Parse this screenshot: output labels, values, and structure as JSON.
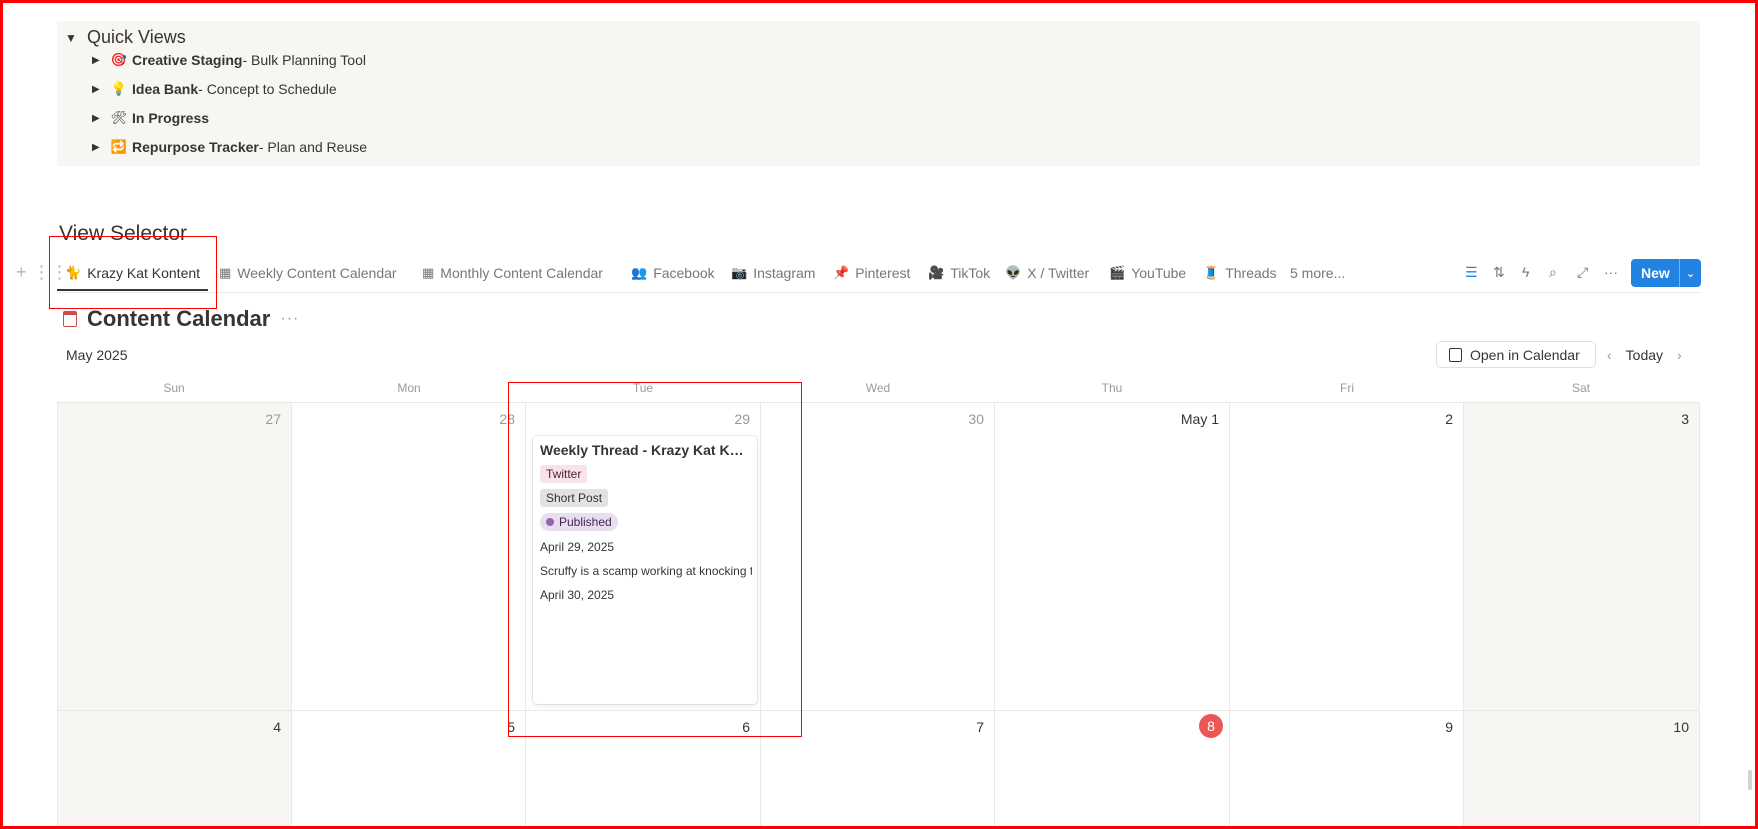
{
  "quick_views": {
    "title": "Quick Views",
    "items": [
      {
        "icon": "🎯",
        "name": "Creative Staging",
        "sub": " - Bulk Planning Tool"
      },
      {
        "icon": "💡",
        "name": "Idea Bank",
        "sub": " - Concept to Schedule"
      },
      {
        "icon": "🛠",
        "name": "In Progress",
        "sub": ""
      },
      {
        "icon": "🔁",
        "name": "Repurpose Tracker",
        "sub": " - Plan and Reuse"
      }
    ]
  },
  "view_selector": {
    "title": "View Selector",
    "tabs": [
      {
        "icon": "🐈",
        "label": "Krazy Kat Kontent"
      },
      {
        "icon": "▦",
        "label": "Weekly Content Calendar"
      },
      {
        "icon": "▦",
        "label": "Monthly Content Calendar"
      },
      {
        "icon": "👥",
        "label": "Facebook"
      },
      {
        "icon": "📷",
        "label": "Instagram"
      },
      {
        "icon": "📌",
        "label": "Pinterest"
      },
      {
        "icon": "🎥",
        "label": "TikTok"
      },
      {
        "icon": "👽",
        "label": "X / Twitter"
      },
      {
        "icon": "🎬",
        "label": "YouTube"
      },
      {
        "icon": "🧵",
        "label": "Threads"
      }
    ],
    "more_label": "5 more...",
    "new_label": "New"
  },
  "calendar": {
    "title": "Content Calendar",
    "month": "May 2025",
    "open_label": "Open in Calendar",
    "today_label": "Today",
    "weekdays": [
      "Sun",
      "Mon",
      "Tue",
      "Wed",
      "Thu",
      "Fri",
      "Sat"
    ],
    "week1": [
      "27",
      "28",
      "29",
      "30",
      "May 1",
      "2",
      "3"
    ],
    "week2": [
      "4",
      "5",
      "6",
      "7",
      "8",
      "9",
      "10"
    ]
  },
  "card": {
    "title": "Weekly Thread - Krazy Kat Kontent",
    "platform": "Twitter",
    "format": "Short Post",
    "status": "Published",
    "date": "April 29, 2025",
    "description": "Scruffy is a scamp working at knocking t",
    "date2": "April 30, 2025"
  },
  "colors": {
    "accent": "#2383e2",
    "today": "#eb5757",
    "annotation": "#ff0000"
  }
}
